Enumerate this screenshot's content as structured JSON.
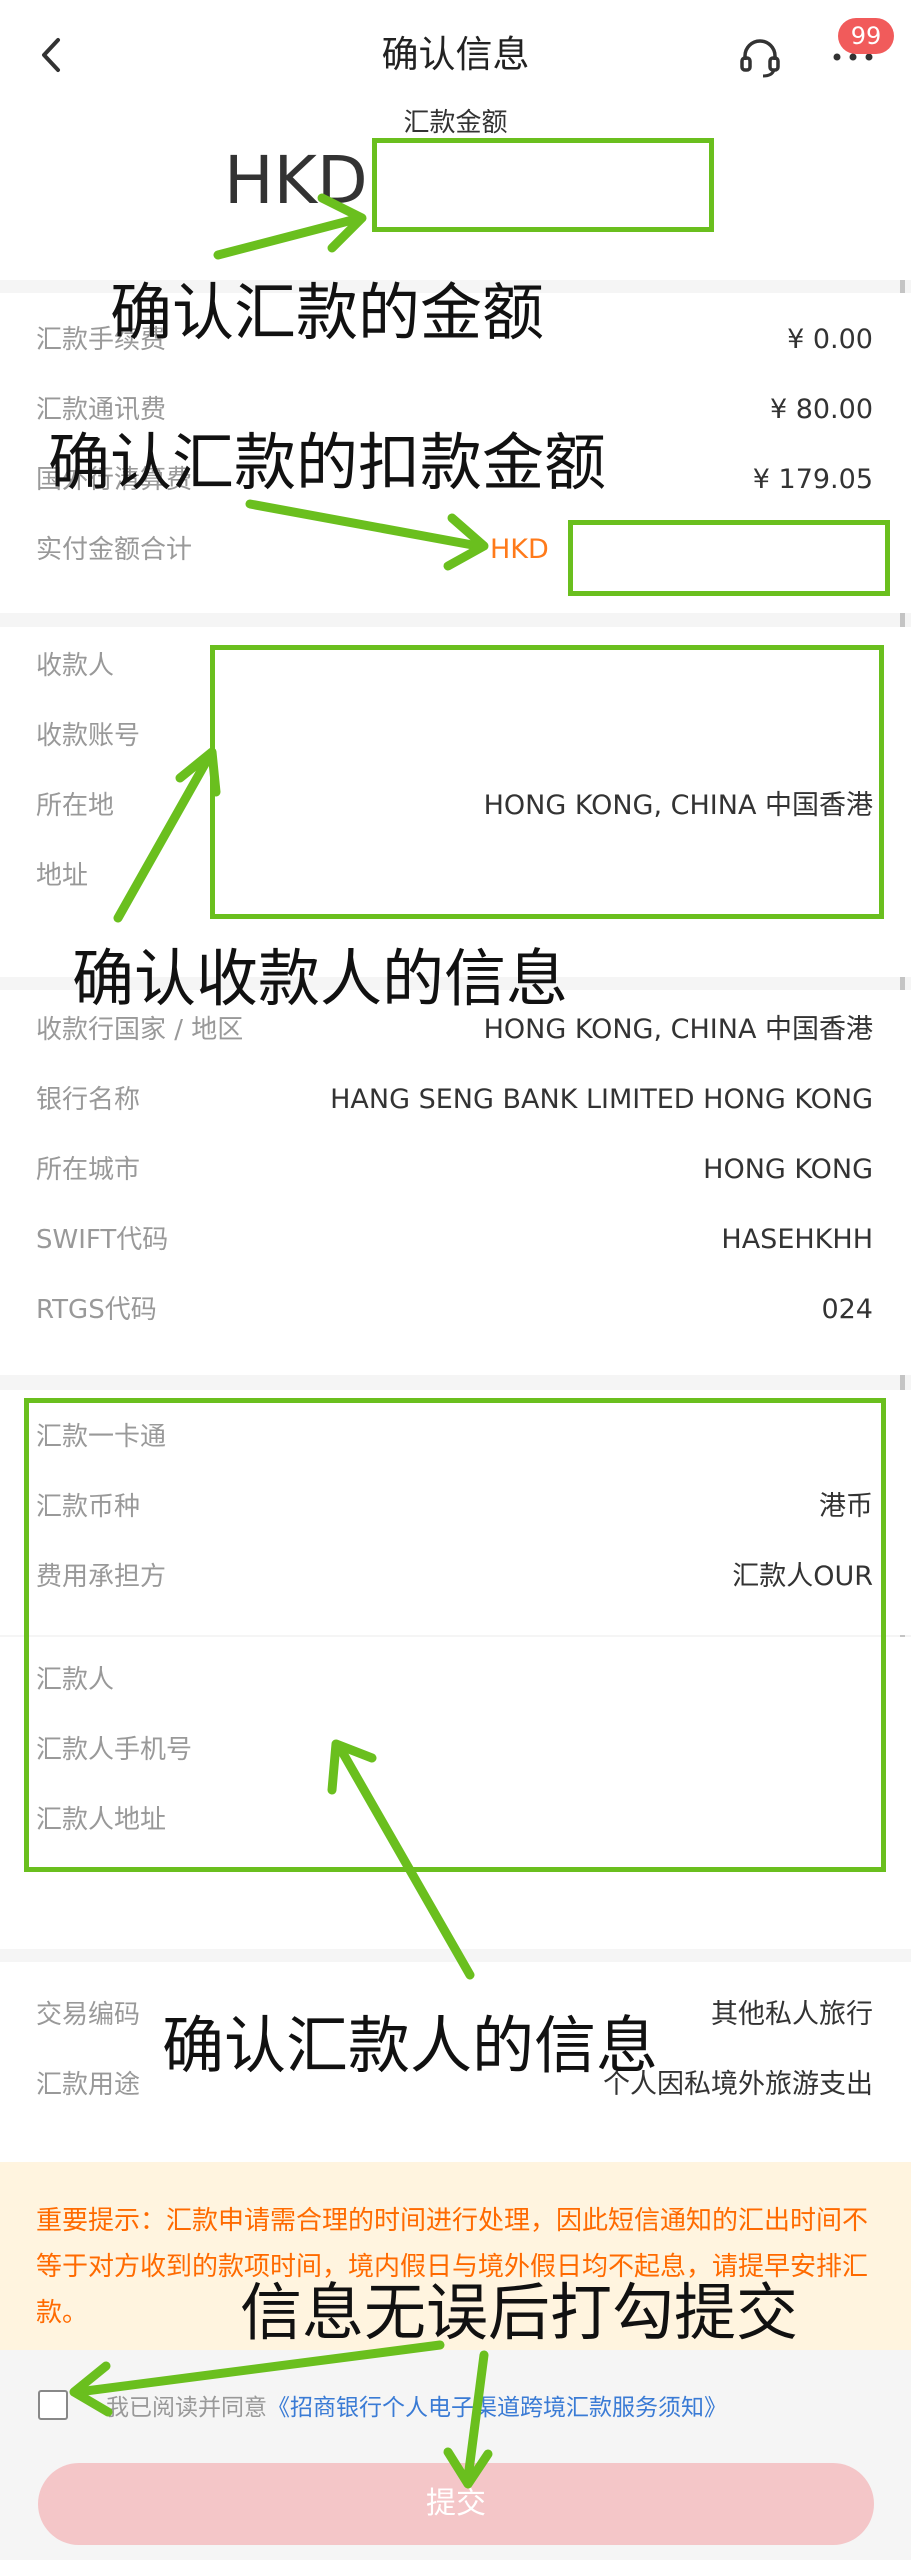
{
  "header": {
    "title": "确认信息",
    "badge_count": "99"
  },
  "amount": {
    "label": "汇款金额",
    "currency": "HKD"
  },
  "fees": {
    "rows": [
      {
        "label": "汇款手续费",
        "value": "¥  0.00"
      },
      {
        "label": "汇款通讯费",
        "value": "¥  80.00"
      },
      {
        "label": "国外行清算费",
        "value": "¥  179.05"
      },
      {
        "label": "实付金额合计",
        "value": "HKD"
      }
    ]
  },
  "payee": {
    "rows": [
      {
        "label": "收款人",
        "value": ""
      },
      {
        "label": "收款账号",
        "value": ""
      },
      {
        "label": "所在地",
        "value": "HONG KONG, CHINA 中国香港"
      },
      {
        "label": "地址",
        "value": ""
      }
    ]
  },
  "bank": {
    "rows": [
      {
        "label": "收款行国家 / 地区",
        "value": "HONG KONG, CHINA 中国香港"
      },
      {
        "label": "银行名称",
        "value": "HANG SENG BANK LIMITED HONG KONG"
      },
      {
        "label": "所在城市",
        "value": "HONG KONG"
      },
      {
        "label": "SWIFT代码",
        "value": "HASEHKHH"
      },
      {
        "label": "RTGS代码",
        "value": "024"
      }
    ]
  },
  "remit_account": {
    "rows": [
      {
        "label": "汇款一卡通",
        "value": ""
      },
      {
        "label": "汇款币种",
        "value": "港币"
      },
      {
        "label": "费用承担方",
        "value": "汇款人OUR"
      }
    ]
  },
  "remitter": {
    "rows": [
      {
        "label": "汇款人",
        "value": ""
      },
      {
        "label": "汇款人手机号",
        "value": ""
      },
      {
        "label": "汇款人地址",
        "value": ""
      }
    ]
  },
  "purpose": {
    "rows": [
      {
        "label": "交易编码",
        "value": "其他私人旅行"
      },
      {
        "label": "汇款用途",
        "value": "个人因私境外旅游支出"
      }
    ]
  },
  "notice": {
    "text": "重要提示：汇款申请需合理的时间进行处理，因此短信通知的汇出时间不等于对方收到的款项时间，境内假日与境外假日均不起息，请提早安排汇款。"
  },
  "agreement": {
    "prefix": "我已阅读并同意",
    "link": "《招商银行个人电子渠道跨境汇款服务须知》"
  },
  "submit_label": "提交",
  "annotations": {
    "confirm_amount": "确认汇款的金额",
    "confirm_debit": "确认汇款的扣款金额",
    "confirm_payee": "确认收款人的信息",
    "confirm_remitter": "确认汇款人的信息",
    "check_submit": "信息无误后打勾提交"
  },
  "colors": {
    "annotation_green": "#6abf1e",
    "notice_orange": "#ff6a00",
    "submit_pink": "#f4c6c8",
    "link_blue": "#3a7bd5"
  }
}
